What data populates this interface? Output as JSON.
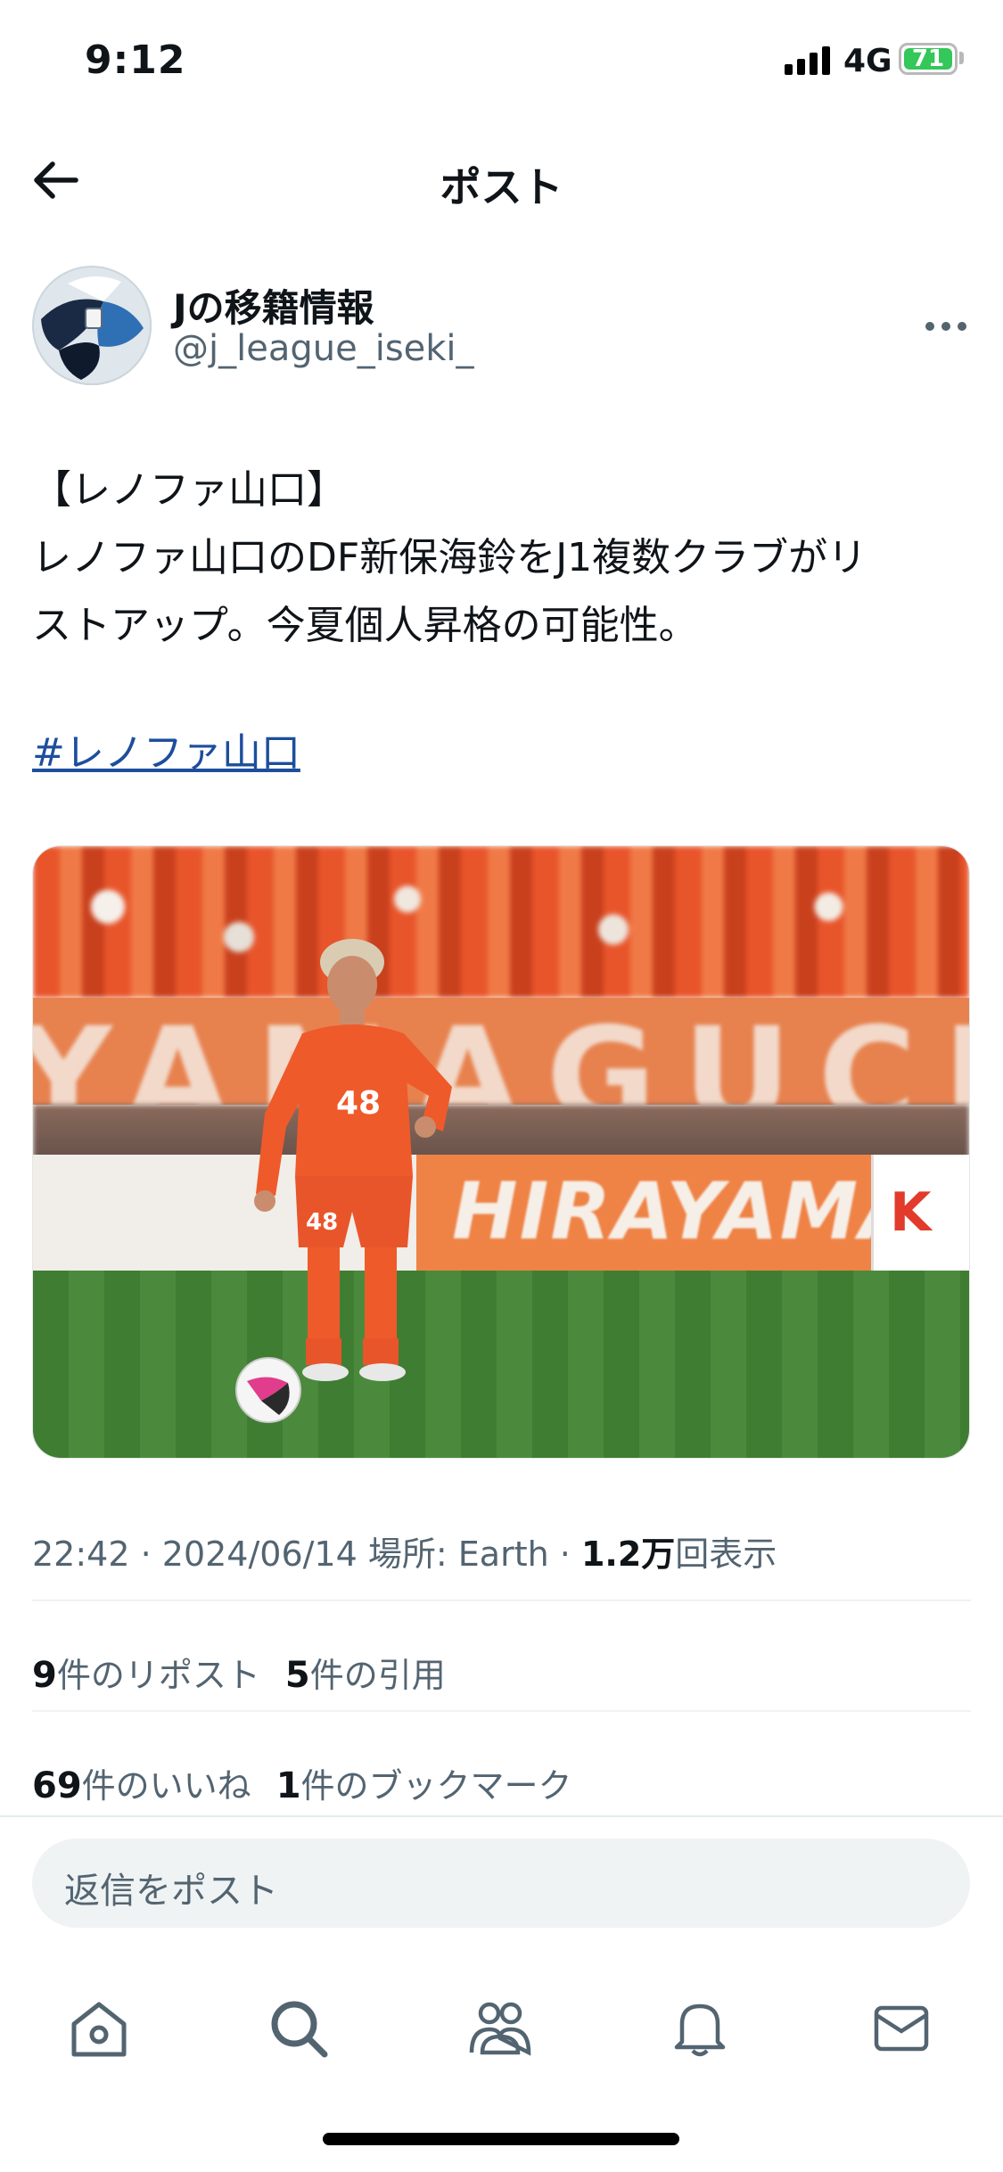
{
  "status_bar": {
    "time": "9:12",
    "network": "4G",
    "battery_level": "71"
  },
  "nav": {
    "title": "ポスト",
    "back_icon": "arrow-left-icon"
  },
  "author": {
    "display_name": "Jの移籍情報",
    "handle": "@j_league_iseki_",
    "more_icon": "more-horizontal-icon"
  },
  "post": {
    "lines": [
      "【レノファ山口】",
      "レノファ山口のDF新保海鈴をJ1複数クラブがリ",
      "ストアップ。今夏個人昇格の可能性。"
    ],
    "hashtag": "#レノファ山口",
    "media": {
      "banner_text": "YAMAGUCHI",
      "adboard_text": "HIRAYAMA",
      "adboard_right": "K",
      "jersey_number": "48"
    }
  },
  "meta": {
    "time": "22:42",
    "separator1": " · ",
    "date": "2024/06/14",
    "location_label": "場所: Earth",
    "separator2": " · ",
    "views_count": "1.2万",
    "views_label": "回表示"
  },
  "stats": {
    "reposts_count": "9",
    "reposts_label": "件のリポスト",
    "quotes_count": "5",
    "quotes_label": "件の引用",
    "likes_count": "69",
    "likes_label": "件のいいね",
    "bookmarks_count": "1",
    "bookmarks_label": "件のブックマーク"
  },
  "reply": {
    "placeholder": "返信をポスト"
  },
  "tab_bar": {
    "icons": [
      "home-icon",
      "search-icon",
      "communities-icon",
      "notifications-icon",
      "messages-icon"
    ]
  },
  "colors": {
    "text_primary": "#0f1419",
    "text_secondary": "#536471",
    "link": "#1d4e9c",
    "reply_bg": "#eff3f4",
    "battery_green": "#34c759",
    "jersey_orange": "#ef5a2a"
  }
}
